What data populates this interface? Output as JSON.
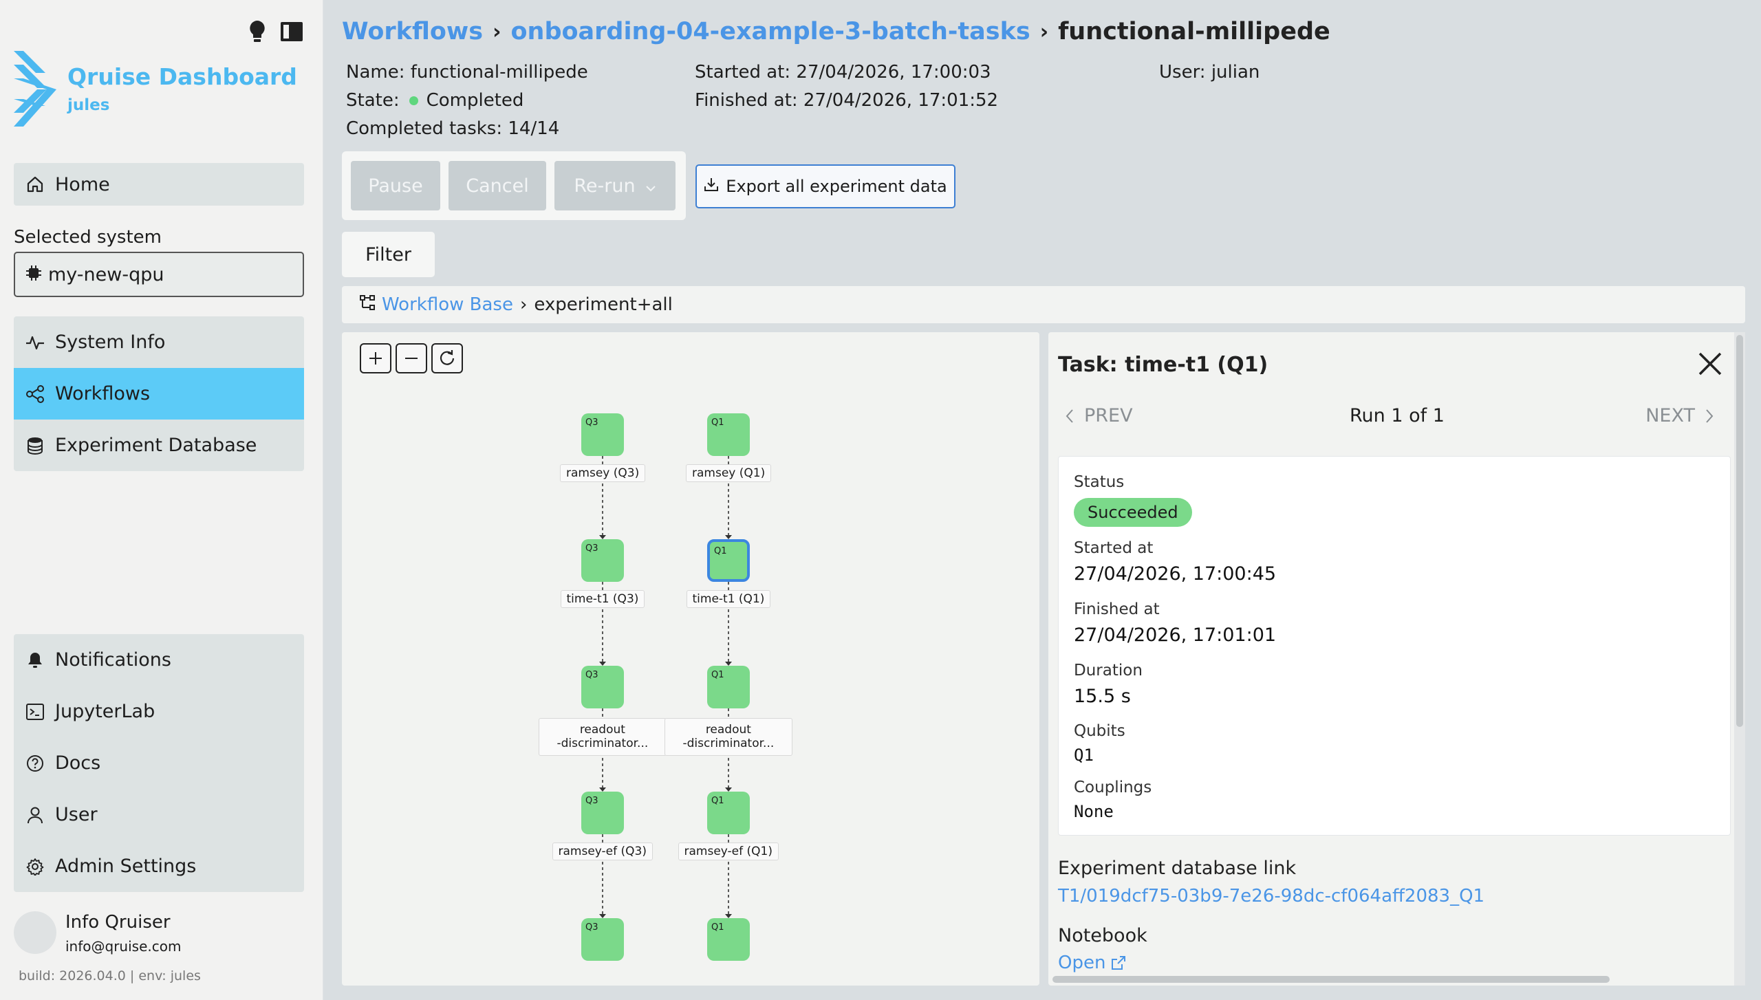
{
  "app": {
    "title": "Qruise Dashboard",
    "subtitle": "jules"
  },
  "sidebar": {
    "home": "Home",
    "selected_system_label": "Selected system",
    "selected_system": "my-new-qpu",
    "nav": [
      {
        "label": "System Info",
        "icon": "activity-icon",
        "active": false
      },
      {
        "label": "Workflows",
        "icon": "share-nodes-icon",
        "active": true
      },
      {
        "label": "Experiment Database",
        "icon": "database-icon",
        "active": false
      }
    ],
    "bottom_nav": [
      {
        "label": "Notifications",
        "icon": "bell-icon"
      },
      {
        "label": "JupyterLab",
        "icon": "terminal-icon"
      },
      {
        "label": "Docs",
        "icon": "help-circle-icon"
      },
      {
        "label": "User",
        "icon": "user-icon"
      },
      {
        "label": "Admin Settings",
        "icon": "gear-icon"
      }
    ],
    "user": {
      "name": "Info Qruiser",
      "email": "info@qruise.com"
    },
    "build": "build: 2026.04.0 | env: jules"
  },
  "breadcrumb": {
    "root": "Workflows",
    "parent": "onboarding-04-example-3-batch-tasks",
    "current": "functional-millipede",
    "separator": "›"
  },
  "workflow_meta": {
    "name": "Name: functional-millipede",
    "state_label": "State:",
    "state_value": "Completed",
    "state_color": "#5fd67e",
    "completed_tasks": "Completed tasks:  14/14",
    "started_at": "Started at: 27/04/2026, 17:00:03",
    "finished_at": "Finished at: 27/04/2026, 17:01:52",
    "user": "User: julian"
  },
  "actions": {
    "pause": "Pause",
    "cancel": "Cancel",
    "rerun": "Re-run",
    "export": "Export all experiment data",
    "filter": "Filter"
  },
  "workflow_crumb": {
    "base": "Workflow Base",
    "current": "experiment+all"
  },
  "graph": {
    "columns": [
      {
        "qubit": "Q3",
        "nodes": [
          "ramsey (Q3)",
          "time-t1 (Q3)",
          "readout\n-discriminator...",
          "ramsey-ef (Q3)",
          ""
        ]
      },
      {
        "qubit": "Q1",
        "nodes": [
          "ramsey (Q1)",
          "time-t1 (Q1)",
          "readout\n-discriminator...",
          "ramsey-ef (Q1)",
          ""
        ]
      }
    ],
    "selected_node": "time-t1 (Q1)",
    "node_color": "#7bd98a"
  },
  "task": {
    "title": "Task: time-t1 (Q1)",
    "prev": "PREV",
    "next": "NEXT",
    "run": "Run 1 of 1",
    "status_label": "Status",
    "status": "Succeeded",
    "started_label": "Started at",
    "started": "27/04/2026, 17:00:45",
    "finished_label": "Finished at",
    "finished": "27/04/2026, 17:01:01",
    "duration_label": "Duration",
    "duration": "15.5 s",
    "qubits_label": "Qubits",
    "qubits": "Q1",
    "couplings_label": "Couplings",
    "couplings": "None",
    "db_link_label": "Experiment database link",
    "db_link": "T1/019dcf75-03b9-7e26-98dc-cf064aff2083_Q1",
    "notebook_label": "Notebook",
    "notebook_link": "Open"
  },
  "colors": {
    "accent": "#4cb8f0",
    "link": "#4a95e6",
    "active_nav": "#5ccbf7",
    "success": "#7bd98a"
  }
}
